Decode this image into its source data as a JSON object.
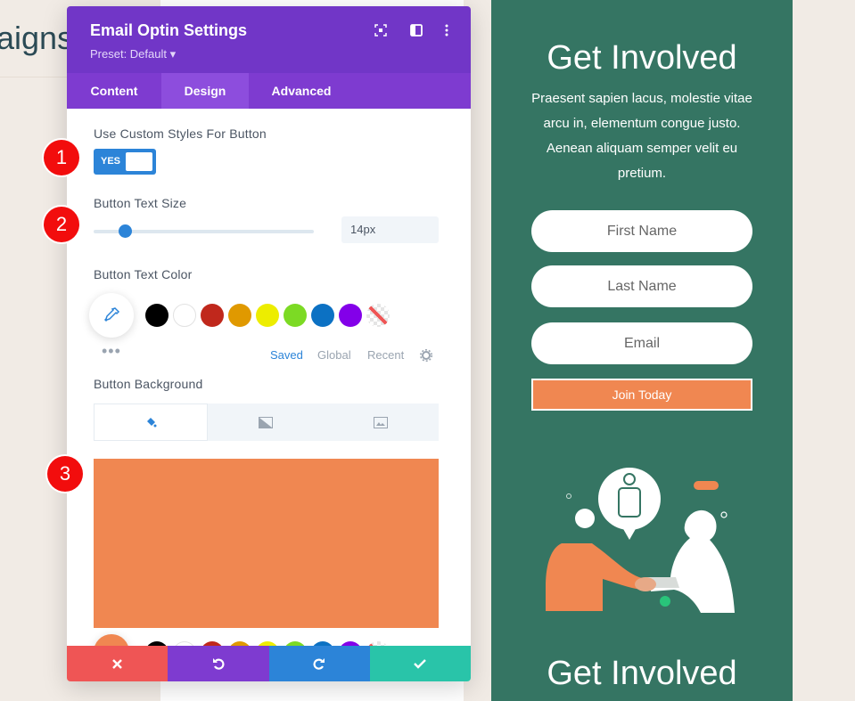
{
  "page": {
    "background_title_fragment": "aigns"
  },
  "modal": {
    "title": "Email Optin Settings",
    "preset": "Preset: Default ▾",
    "header_icons": [
      "focus-icon",
      "layout-icon",
      "more-vertical-icon"
    ],
    "tabs": [
      {
        "label": "Content",
        "active": false
      },
      {
        "label": "Design",
        "active": true
      },
      {
        "label": "Advanced",
        "active": false
      }
    ],
    "custom_styles": {
      "label": "Use Custom Styles For Button",
      "toggle_value": "YES"
    },
    "text_size": {
      "label": "Button Text Size",
      "value": "14px",
      "level": 0.14
    },
    "text_color": {
      "label": "Button Text Color",
      "swatches": [
        "#000000",
        "#ffffff",
        "#c0281c",
        "#e09900",
        "#eded00",
        "#7cda24",
        "#0c71c3",
        "#8300e9"
      ],
      "palette_tabs": [
        {
          "label": "Saved",
          "active": true
        },
        {
          "label": "Global",
          "active": false
        },
        {
          "label": "Recent",
          "active": false
        }
      ]
    },
    "background": {
      "label": "Button Background",
      "tabs": [
        "paint-bucket-icon",
        "gradient-icon",
        "image-icon"
      ],
      "color": "#f08751"
    },
    "footer": [
      "close-icon",
      "undo-icon",
      "redo-icon",
      "check-icon"
    ],
    "footer_colors": [
      "#ef5555",
      "#7e3bd0",
      "#2c84d8",
      "#29c4a9"
    ]
  },
  "badges": [
    "1",
    "2",
    "3"
  ],
  "preview": {
    "title": "Get Involved",
    "body": "Praesent sapien lacus, molestie vitae arcu in, elementum congue justo. Aenean aliquam semper velit eu pretium.",
    "inputs": [
      "First Name",
      "Last Name",
      "Email"
    ],
    "button": "Join Today",
    "title_bottom": "Get Involved",
    "colors": {
      "background": "#357563",
      "accent": "#f08751"
    }
  }
}
